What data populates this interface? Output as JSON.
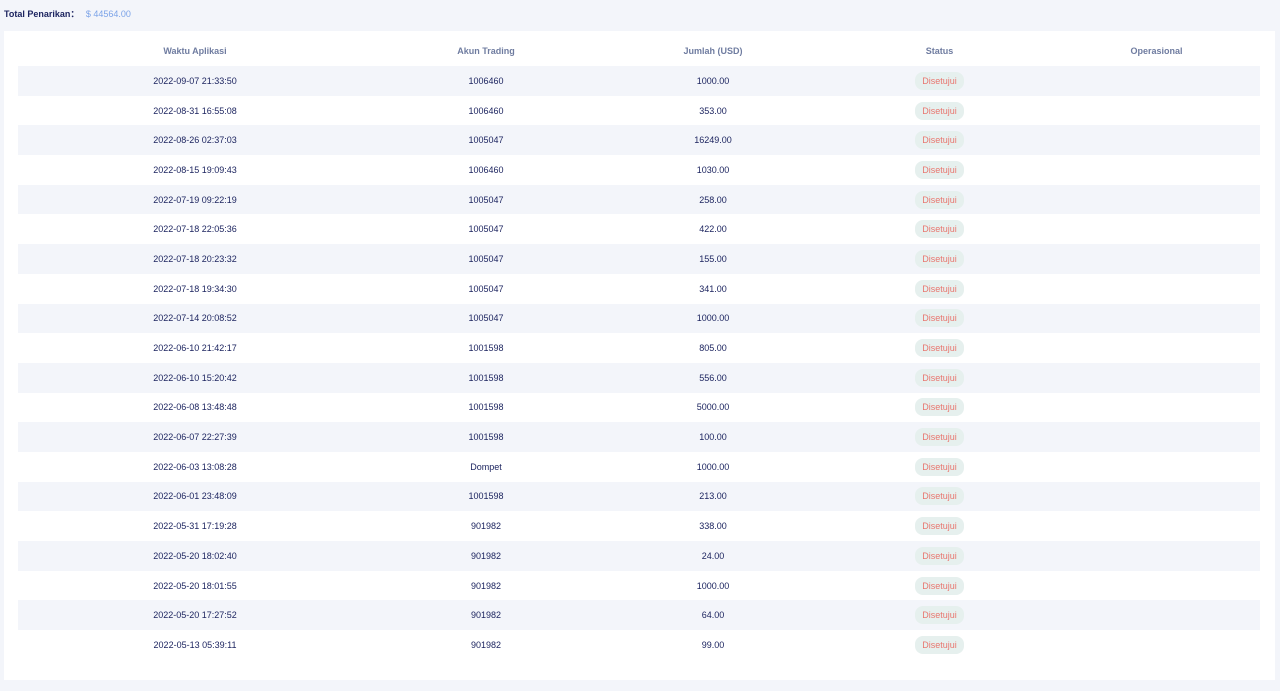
{
  "summary": {
    "label": "Total Penarikan：",
    "value": "$ 44564.00"
  },
  "table": {
    "headers": {
      "time": "Waktu Aplikasi",
      "account": "Akun Trading",
      "amount": "Jumlah (USD)",
      "status": "Status",
      "operation": "Operasional"
    },
    "rows": [
      {
        "time": "2022-09-07 21:33:50",
        "account": "1006460",
        "amount": "1000.00",
        "status": "Disetujui"
      },
      {
        "time": "2022-08-31 16:55:08",
        "account": "1006460",
        "amount": "353.00",
        "status": "Disetujui"
      },
      {
        "time": "2022-08-26 02:37:03",
        "account": "1005047",
        "amount": "16249.00",
        "status": "Disetujui"
      },
      {
        "time": "2022-08-15 19:09:43",
        "account": "1006460",
        "amount": "1030.00",
        "status": "Disetujui"
      },
      {
        "time": "2022-07-19 09:22:19",
        "account": "1005047",
        "amount": "258.00",
        "status": "Disetujui"
      },
      {
        "time": "2022-07-18 22:05:36",
        "account": "1005047",
        "amount": "422.00",
        "status": "Disetujui"
      },
      {
        "time": "2022-07-18 20:23:32",
        "account": "1005047",
        "amount": "155.00",
        "status": "Disetujui"
      },
      {
        "time": "2022-07-18 19:34:30",
        "account": "1005047",
        "amount": "341.00",
        "status": "Disetujui"
      },
      {
        "time": "2022-07-14 20:08:52",
        "account": "1005047",
        "amount": "1000.00",
        "status": "Disetujui"
      },
      {
        "time": "2022-06-10 21:42:17",
        "account": "1001598",
        "amount": "805.00",
        "status": "Disetujui"
      },
      {
        "time": "2022-06-10 15:20:42",
        "account": "1001598",
        "amount": "556.00",
        "status": "Disetujui"
      },
      {
        "time": "2022-06-08 13:48:48",
        "account": "1001598",
        "amount": "5000.00",
        "status": "Disetujui"
      },
      {
        "time": "2022-06-07 22:27:39",
        "account": "1001598",
        "amount": "100.00",
        "status": "Disetujui"
      },
      {
        "time": "2022-06-03 13:08:28",
        "account": "Dompet",
        "amount": "1000.00",
        "status": "Disetujui"
      },
      {
        "time": "2022-06-01 23:48:09",
        "account": "1001598",
        "amount": "213.00",
        "status": "Disetujui"
      },
      {
        "time": "2022-05-31 17:19:28",
        "account": "901982",
        "amount": "338.00",
        "status": "Disetujui"
      },
      {
        "time": "2022-05-20 18:02:40",
        "account": "901982",
        "amount": "24.00",
        "status": "Disetujui"
      },
      {
        "time": "2022-05-20 18:01:55",
        "account": "901982",
        "amount": "1000.00",
        "status": "Disetujui"
      },
      {
        "time": "2022-05-20 17:27:52",
        "account": "901982",
        "amount": "64.00",
        "status": "Disetujui"
      },
      {
        "time": "2022-05-13 05:39:11",
        "account": "901982",
        "amount": "99.00",
        "status": "Disetujui"
      }
    ]
  },
  "colors": {
    "badge_background": "#e6f0ee",
    "badge_text": "#e8766f",
    "summary_value": "#7ba3e8",
    "text_primary": "#1d2560",
    "header_text": "#6f7ca0",
    "stripe": "#f3f5fa"
  }
}
